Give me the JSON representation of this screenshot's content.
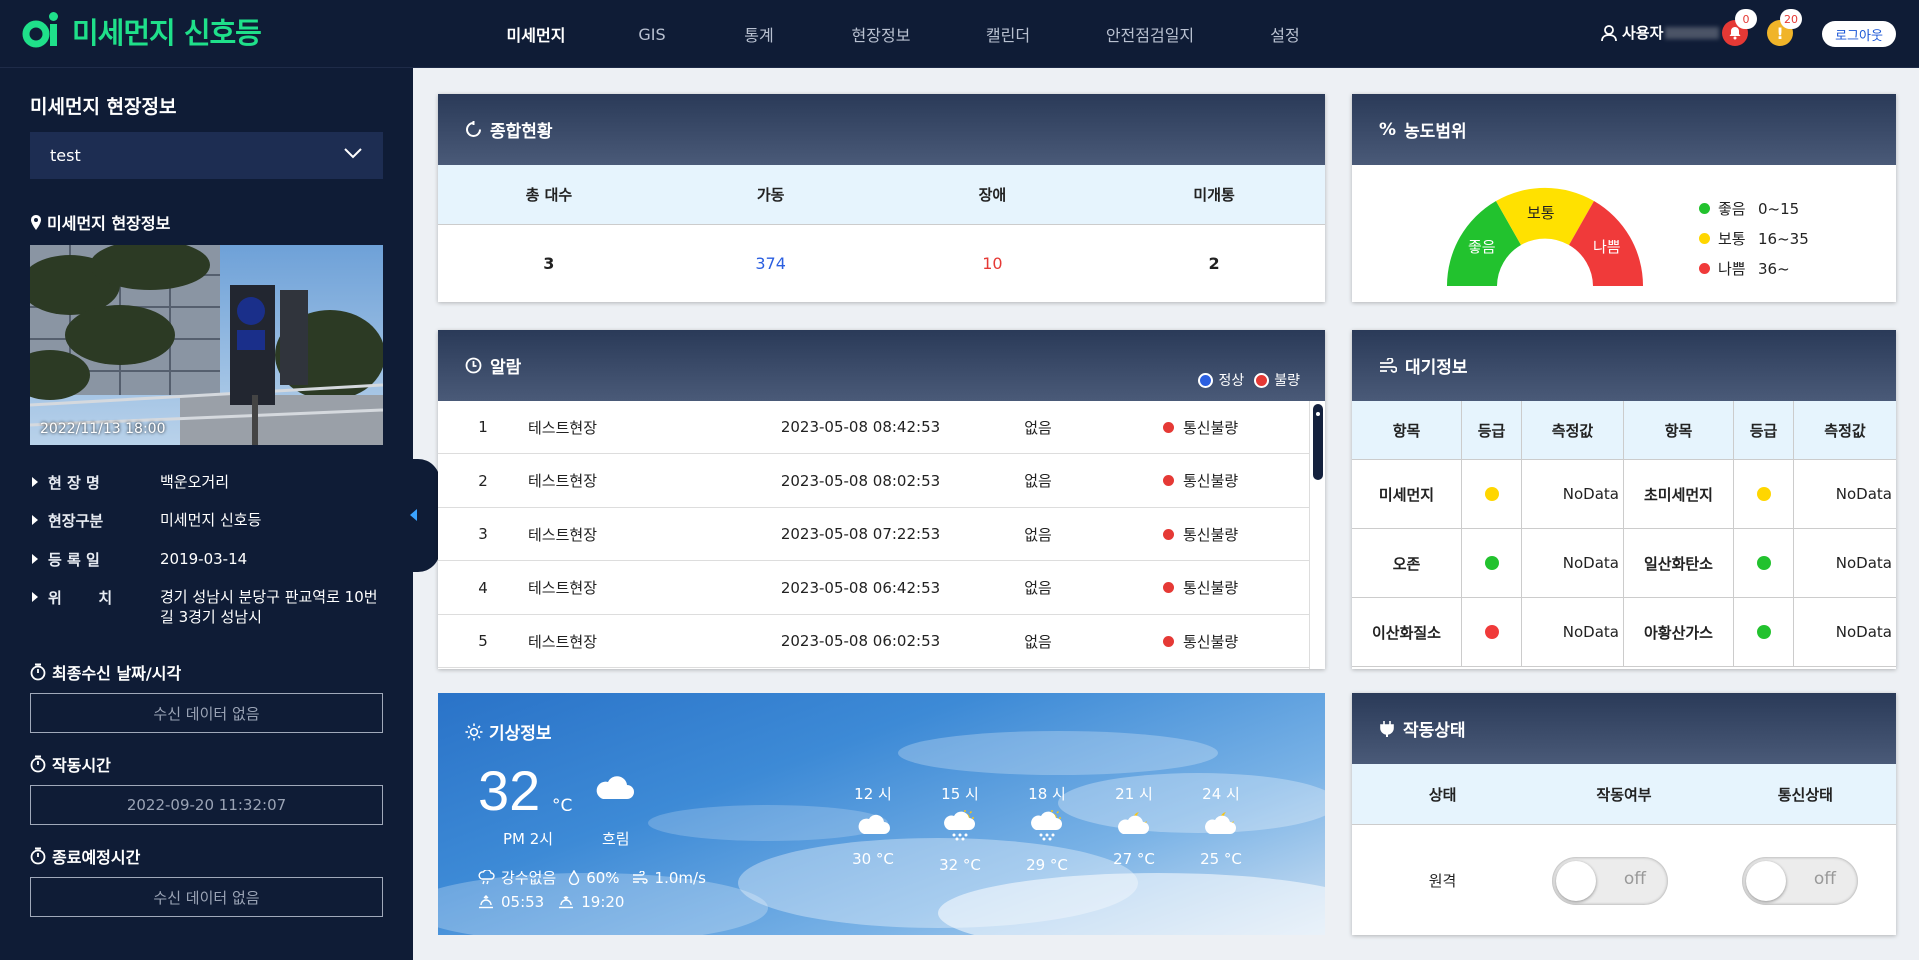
{
  "header": {
    "app_title": "미세먼지 신호등",
    "nav": [
      {
        "label": "미세먼지",
        "active": true
      },
      {
        "label": "GIS"
      },
      {
        "label": "통계"
      },
      {
        "label": "현장정보"
      },
      {
        "label": "캘린더"
      },
      {
        "label": "안전점검일지"
      },
      {
        "label": "설정"
      }
    ],
    "user_label": "사용자",
    "alert_count_red": "0",
    "alert_count_yellow": "20",
    "logout_label": "로그아웃"
  },
  "sidebar": {
    "title": "미세먼지 현장정보",
    "site_select_value": "test",
    "section_title": "미세먼지 현장정보",
    "photo_date": "2022/11/13 18:00",
    "info": [
      {
        "key": "현 장 명",
        "value": "백운오거리"
      },
      {
        "key": "현장구분",
        "value": "미세먼지 신호등"
      },
      {
        "key": "등 록 일",
        "value": "2019-03-14"
      },
      {
        "key": "위       치",
        "value": "경기 성남시 분당구 판교역로 10번길 3경기 성남시"
      }
    ],
    "last_receive_label": "최종수신 날짜/시각",
    "last_receive_value": "수신 데이터 없음",
    "operation_time_label": "작동시간",
    "operation_time_value": "2022-09-20 11:32:07",
    "end_time_label": "종료예정시간",
    "end_time_value": "수신 데이터 없음"
  },
  "summary": {
    "title": "종합현황",
    "headers": [
      "총 대수",
      "가동",
      "장애",
      "미개통"
    ],
    "values": [
      "3",
      "374",
      "10",
      "2"
    ],
    "value_colors": [
      "#222222",
      "#2b5fe0",
      "#e53935",
      "#222222"
    ]
  },
  "range": {
    "title": "농도범위",
    "gauge": [
      "좋음",
      "보통",
      "나쁨"
    ],
    "legend": [
      {
        "label": "좋음",
        "range": "0~15",
        "color": "#22c22e"
      },
      {
        "label": "보통",
        "range": "16~35",
        "color": "#ffd600"
      },
      {
        "label": "나쁨",
        "range": "36~",
        "color": "#f03a3a"
      }
    ]
  },
  "alarm": {
    "title": "알람",
    "legend_normal": "정상",
    "legend_bad": "불량",
    "rows": [
      {
        "no": "1",
        "site": "테스트현장",
        "time": "2023-05-08 08:42:53",
        "value": "없음",
        "status": "통신불량"
      },
      {
        "no": "2",
        "site": "테스트현장",
        "time": "2023-05-08 08:02:53",
        "value": "없음",
        "status": "통신불량"
      },
      {
        "no": "3",
        "site": "테스트현장",
        "time": "2023-05-08 07:22:53",
        "value": "없음",
        "status": "통신불량"
      },
      {
        "no": "4",
        "site": "테스트현장",
        "time": "2023-05-08 06:42:53",
        "value": "없음",
        "status": "통신불량"
      },
      {
        "no": "5",
        "site": "테스트현장",
        "time": "2023-05-08 06:02:53",
        "value": "없음",
        "status": "통신불량"
      }
    ]
  },
  "air": {
    "title": "대기정보",
    "headers": [
      "항목",
      "등급",
      "측정값",
      "항목",
      "등급",
      "측정값"
    ],
    "rows": [
      {
        "a_name": "미세먼지",
        "a_color": "#ffd600",
        "a_value": "NoData",
        "b_name": "초미세먼지",
        "b_color": "#ffd600",
        "b_value": "NoData"
      },
      {
        "a_name": "오존",
        "a_color": "#22c22e",
        "a_value": "NoData",
        "b_name": "일산화탄소",
        "b_color": "#22c22e",
        "b_value": "NoData"
      },
      {
        "a_name": "이산화질소",
        "a_color": "#f03a3a",
        "a_value": "NoData",
        "b_name": "아황산가스",
        "b_color": "#22c22e",
        "b_value": "NoData"
      }
    ]
  },
  "weather": {
    "title": "기상정보",
    "temp": "32",
    "unit": "°C",
    "time": "PM 2시",
    "condition": "흐림",
    "precip": "강수없음",
    "humidity": "60%",
    "wind": "1.0m/s",
    "sunrise": "05:53",
    "sunset": "19:20",
    "forecast": [
      {
        "hour": "12 시",
        "icon": "cloudy-icon",
        "temp": "30 °C"
      },
      {
        "hour": "15 시",
        "icon": "sun-rain-icon",
        "temp": "32 °C"
      },
      {
        "hour": "18 시",
        "icon": "sun-rain-icon",
        "temp": "29 °C"
      },
      {
        "hour": "21 시",
        "icon": "moon-cloud-icon",
        "temp": "27 °C"
      },
      {
        "hour": "24 시",
        "icon": "moon-cloud-icon",
        "temp": "25 °C"
      }
    ]
  },
  "operation": {
    "title": "작동상태",
    "headers": [
      "상태",
      "작동여부",
      "통신상태"
    ],
    "row_label": "원격",
    "power_state": "off",
    "comm_state": "off"
  }
}
